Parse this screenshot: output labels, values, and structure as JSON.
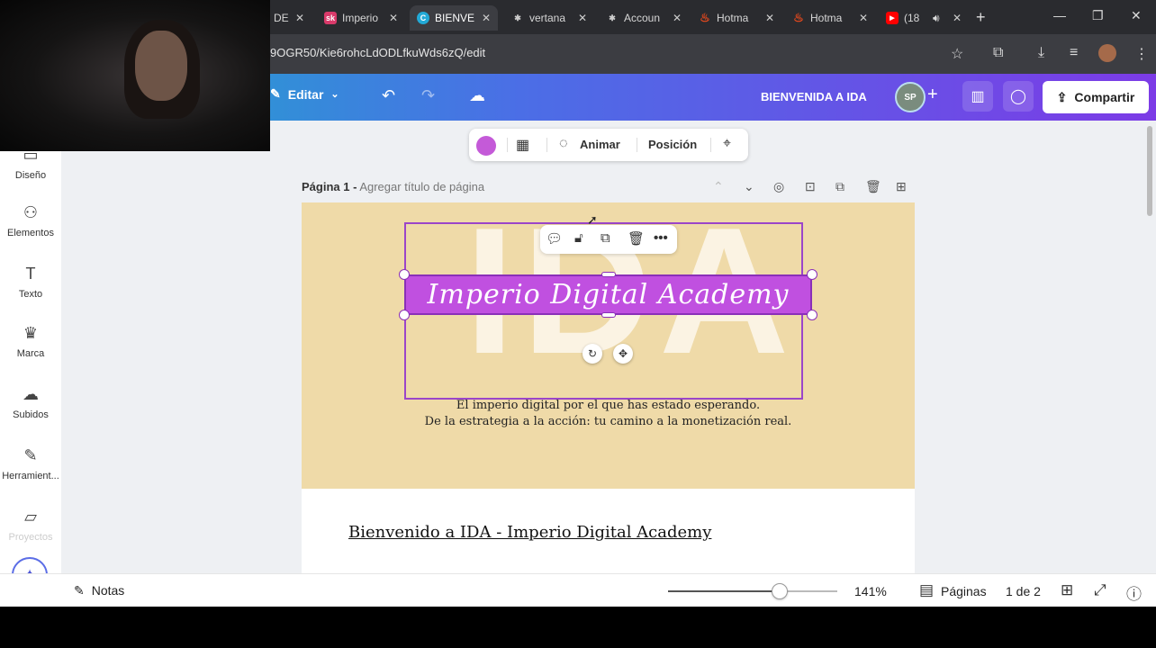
{
  "browser": {
    "tabs": [
      {
        "title": "DE",
        "icon": "canva-icon",
        "active": false
      },
      {
        "title": "Imperio",
        "icon": "sk-icon",
        "icon_text": "sk",
        "icon_color": "#d93a6a",
        "active": false
      },
      {
        "title": "BIENVE",
        "icon": "canva-icon",
        "icon_text": "C",
        "icon_color": "#22a9d6",
        "active": true
      },
      {
        "title": "vertana",
        "icon": "hotmart-gear-icon",
        "icon_text": "✱",
        "icon_color": "#777777",
        "active": false
      },
      {
        "title": "Accoun",
        "icon": "hotmart-gear-icon",
        "icon_text": "✱",
        "icon_color": "#777777",
        "active": false
      },
      {
        "title": "Hotma",
        "icon": "hotmart-flame-icon",
        "icon_text": "♨",
        "icon_color": "#e8491d",
        "active": false
      },
      {
        "title": "Hotma",
        "icon": "hotmart-flame-icon",
        "icon_text": "♨",
        "icon_color": "#e8491d",
        "active": false
      },
      {
        "title": "(18",
        "icon": "youtube-icon",
        "icon_text": "▶",
        "icon_color": "#ff0000",
        "active": false
      }
    ],
    "url": "9OGR50/Kie6rohcLdODLfkuWds6zQ/edit"
  },
  "canva": {
    "edit_label": "Editar",
    "doc_title": "BIENVENIDA A IDA",
    "avatar_text": "SP",
    "share_label": "Compartir"
  },
  "sidebar": {
    "items": [
      {
        "label": "Diseño",
        "icon": "layout-icon"
      },
      {
        "label": "Elementos",
        "icon": "shapes-icon"
      },
      {
        "label": "Texto",
        "icon": "text-icon"
      },
      {
        "label": "Marca",
        "icon": "brand-icon"
      },
      {
        "label": "Subidos",
        "icon": "cloud-upload-icon"
      },
      {
        "label": "Herramient...",
        "icon": "pen-tool-icon"
      },
      {
        "label": "Proyectos",
        "icon": "folder-icon"
      }
    ]
  },
  "context_toolbar": {
    "animate_label": "Animar",
    "position_label": "Posición",
    "color": "#c45ad8"
  },
  "page1": {
    "label": "Página 1 -",
    "title_placeholder": "Agregar título de página",
    "big_text": "IDA",
    "banner_text": "Imperio Digital Academy",
    "tagline_1": "El imperio digital por el que has estado esperando.",
    "tagline_2": "De la estrategia a la acción: tu camino a la monetización real.",
    "background_color": "#efdaa8"
  },
  "page2": {
    "heading": "Bienvenido a IDA - Imperio Digital Academy"
  },
  "bottombar": {
    "notes_label": "Notas",
    "zoom_value": 141,
    "zoom_label": "141%",
    "pages_label": "Páginas",
    "page_counter": "1 de 2",
    "zoom_slider_fraction": 0.66
  }
}
